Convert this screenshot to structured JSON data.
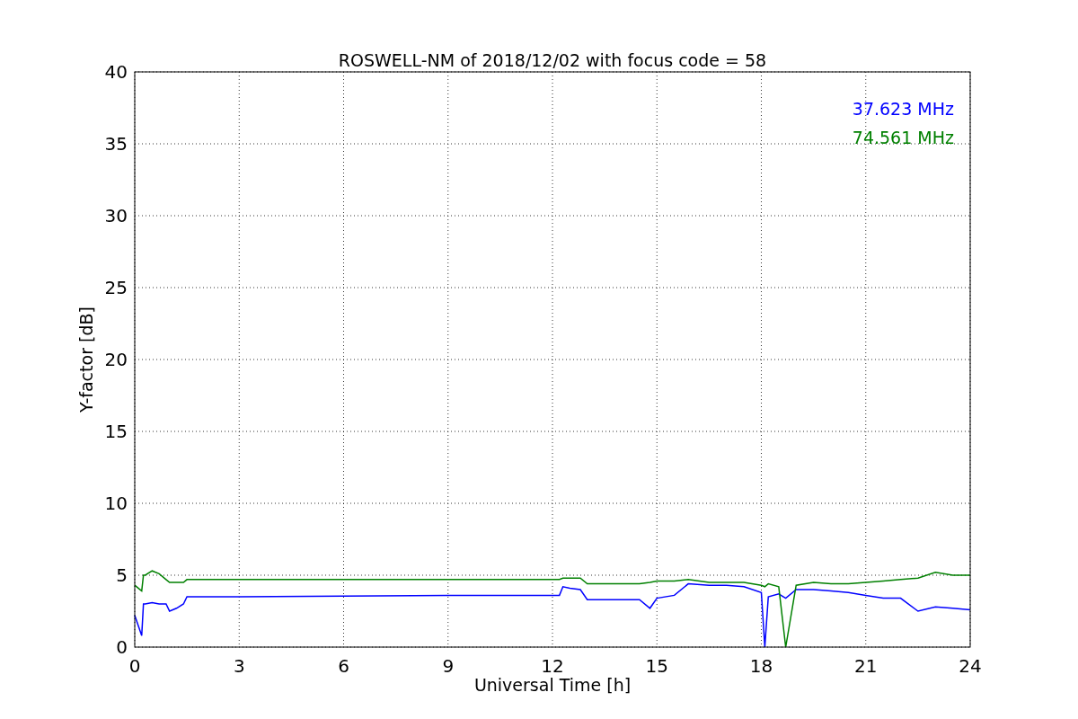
{
  "figure": {
    "chart_data": {
      "type": "line",
      "title": "ROSWELL-NM of 2018/12/02 with focus code = 58",
      "xlabel": "Universal Time [h]",
      "ylabel": "Y-factor [dB]",
      "x": [
        0,
        0.1,
        0.2,
        0.25,
        0.3,
        0.5,
        0.7,
        0.9,
        1.0,
        1.2,
        1.4,
        1.5,
        3,
        6,
        9,
        12.2,
        12.3,
        12.5,
        12.8,
        13,
        13.5,
        14,
        14.5,
        14.8,
        15,
        15.5,
        15.9,
        16.5,
        17,
        17.5,
        18,
        18.1,
        18.2,
        18.5,
        18.7,
        19,
        19.5,
        20,
        20.5,
        21,
        21.5,
        22,
        22.5,
        23,
        23.5,
        24
      ],
      "series": [
        {
          "name": "37.623 MHz",
          "color": "#0000ff",
          "values": [
            2.2,
            1.5,
            0.8,
            3.0,
            3.0,
            3.1,
            3.0,
            3.0,
            2.5,
            2.7,
            3.0,
            3.5,
            3.5,
            3.55,
            3.6,
            3.6,
            4.2,
            4.1,
            4.0,
            3.3,
            3.3,
            3.3,
            3.3,
            2.7,
            3.4,
            3.6,
            4.4,
            4.3,
            4.3,
            4.2,
            3.8,
            0,
            3.5,
            3.7,
            3.4,
            4.0,
            4.0,
            3.9,
            3.8,
            3.6,
            3.4,
            3.4,
            2.5,
            2.8,
            2.7,
            2.6
          ]
        },
        {
          "name": "74.561 MHz",
          "color": "#008000",
          "values": [
            4.3,
            4.1,
            3.9,
            5.0,
            5.0,
            5.3,
            5.1,
            4.7,
            4.5,
            4.5,
            4.5,
            4.7,
            4.7,
            4.7,
            4.7,
            4.7,
            4.8,
            4.8,
            4.8,
            4.4,
            4.4,
            4.4,
            4.4,
            4.5,
            4.6,
            4.6,
            4.7,
            4.5,
            4.5,
            4.5,
            4.3,
            4.2,
            4.4,
            4.2,
            0,
            4.3,
            4.5,
            4.4,
            4.4,
            4.5,
            4.6,
            4.7,
            4.8,
            5.2,
            5.0,
            5.0
          ]
        }
      ],
      "grid": true,
      "xlim": [
        0,
        24
      ],
      "ylim": [
        0,
        40
      ],
      "xticks": [
        0,
        3,
        6,
        9,
        12,
        15,
        18,
        21,
        24
      ],
      "yticks": [
        0,
        5,
        10,
        15,
        20,
        25,
        30,
        35,
        40
      ]
    }
  }
}
